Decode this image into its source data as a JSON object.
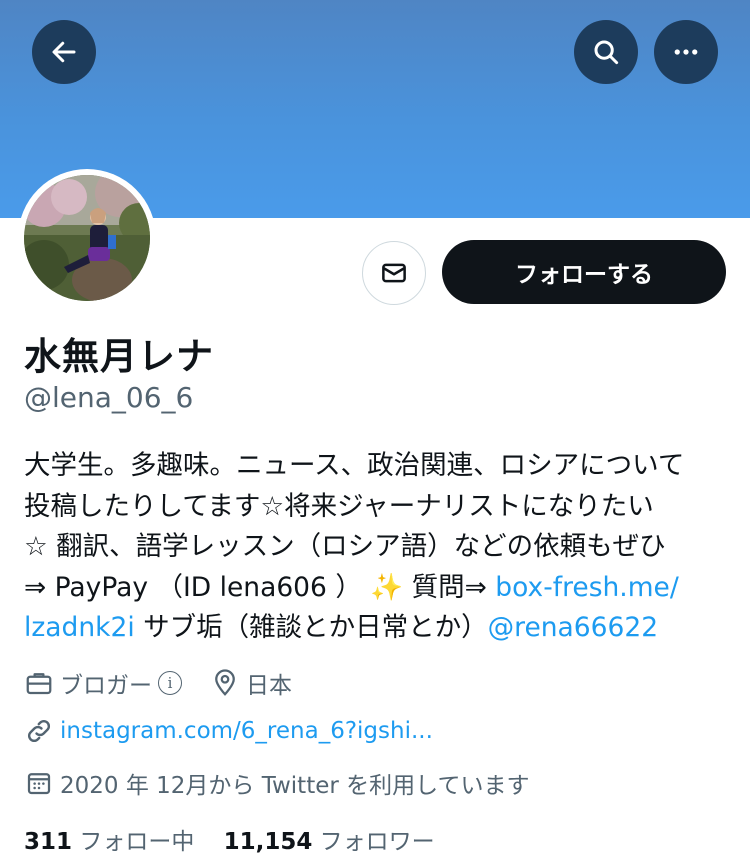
{
  "header": {
    "back_icon": "arrow-left-icon",
    "search_icon": "search-icon",
    "more_icon": "more-horizontal-icon"
  },
  "profile": {
    "display_name": "水無月レナ",
    "handle": "@lena_06_6",
    "follow_label": "フォローする",
    "message_icon": "mail-icon"
  },
  "bio": {
    "line1": "大学生。多趣味。ニュース、政治関連、ロシアについて",
    "line2": "投稿したりしてます☆将来ジャーナリストになりたい",
    "line3": "☆ 翻訳、語学レッスン（ロシア語）などの依頼もぜひ",
    "line4_text": "⇒ PayPay （ID lena606 ） ✨ 質問⇒ ",
    "line4_link": "box-fresh.me/",
    "line5_link": "lzadnk2i",
    "line5_text": " サブ垢（雑談とか日常とか）",
    "line5_mention": "@rena66622"
  },
  "meta": {
    "category": "ブロガー",
    "info_mark": "i",
    "location": "日本",
    "website": "instagram.com/6_rena_6?igshi...",
    "joined": "2020 年 12月から Twitter を利用しています"
  },
  "stats": {
    "following_count": "311",
    "following_label": "フォロー中",
    "followers_count": "11,154",
    "followers_label": "フォロワー"
  },
  "colors": {
    "accent": "#1d9bf0",
    "button_dark": "#0f1419",
    "secondary_text": "#536471",
    "banner": "#4a93dc"
  }
}
